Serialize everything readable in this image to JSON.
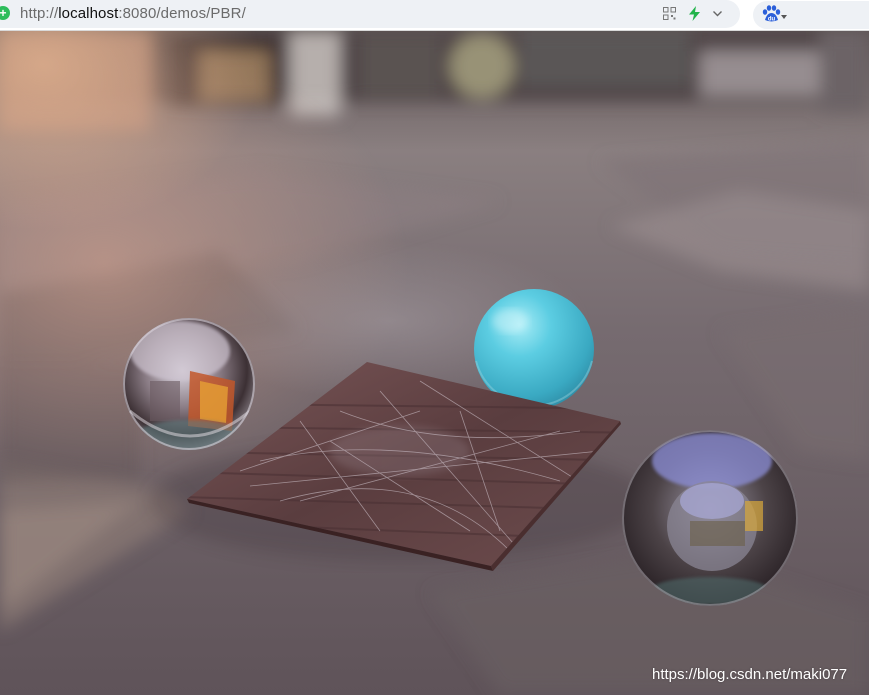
{
  "browser": {
    "url_prefix": "http://",
    "url_host": "localhost",
    "url_rest": ":8080/demos/PBR/",
    "icons": [
      "site-icon",
      "qr-code-icon",
      "lightning-icon",
      "chevron-down-icon",
      "baidu-paw-icon",
      "caret-down-icon"
    ]
  },
  "scene": {
    "objects": [
      "chrome-sphere-left",
      "cyan-sphere",
      "wood-plane",
      "glass-sphere-right"
    ],
    "colors": {
      "cyan_sphere": "#55c8dc",
      "wood": "#6e4a48",
      "chrome": "#c9c9d2"
    }
  },
  "watermark": {
    "text": "https://blog.csdn.net/maki077"
  }
}
